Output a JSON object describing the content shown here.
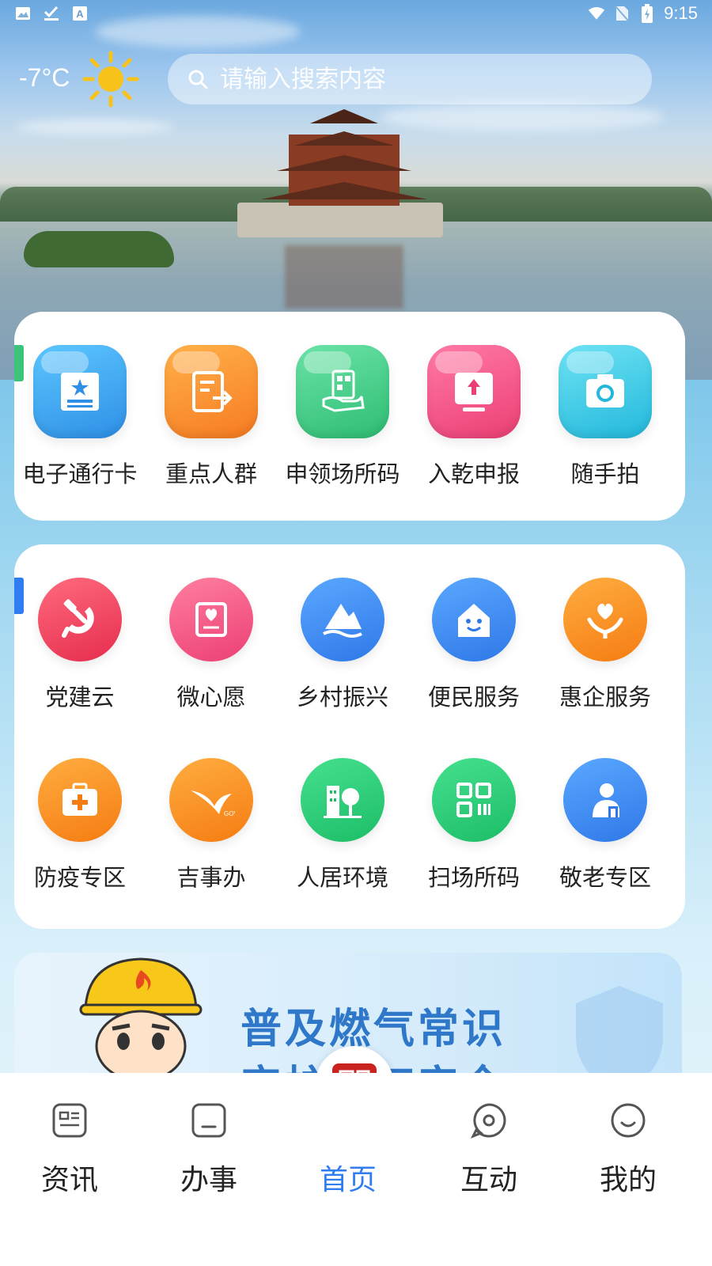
{
  "status_bar": {
    "time": "9:15"
  },
  "header": {
    "temperature": "-7°C",
    "weather_icon": "sun-icon",
    "search_placeholder": "请输入搜索内容"
  },
  "quick_services": [
    {
      "label": "电子通行卡",
      "icon": "id-card-icon",
      "color": "#3aa6f0"
    },
    {
      "label": "重点人群",
      "icon": "document-arrow-icon",
      "color": "#f7922f"
    },
    {
      "label": "申领场所码",
      "icon": "hand-qr-icon",
      "color": "#3ecf86"
    },
    {
      "label": "入乾申报",
      "icon": "upload-icon",
      "color": "#f24f84"
    },
    {
      "label": "随手拍",
      "icon": "camera-icon",
      "color": "#3cc9e6"
    }
  ],
  "services": [
    {
      "label": "党建云",
      "icon": "hammer-sickle-icon",
      "color": "#f0445f"
    },
    {
      "label": "微心愿",
      "icon": "heart-card-icon",
      "color": "#f25a84"
    },
    {
      "label": "乡村振兴",
      "icon": "mountain-icon",
      "color": "#3d8ef0"
    },
    {
      "label": "便民服务",
      "icon": "smile-house-icon",
      "color": "#3b8cf0"
    },
    {
      "label": "惠企服务",
      "icon": "heart-hands-icon",
      "color": "#f78d22"
    },
    {
      "label": "防疫专区",
      "icon": "medical-kit-icon",
      "color": "#f7922f"
    },
    {
      "label": "吉事办",
      "icon": "bird-icon",
      "color": "#f7922f"
    },
    {
      "label": "人居环境",
      "icon": "building-tree-icon",
      "color": "#2ed47a"
    },
    {
      "label": "扫场所码",
      "icon": "qr-code-icon",
      "color": "#2ed47a"
    },
    {
      "label": "敬老专区",
      "icon": "elderly-icon",
      "color": "#3b8cf0"
    }
  ],
  "banner": {
    "line1": "普及燃气常识",
    "line2": "守护燃气安全"
  },
  "bottom_nav": [
    {
      "label": "资讯",
      "icon": "news-icon",
      "active": false
    },
    {
      "label": "办事",
      "icon": "task-icon",
      "active": false
    },
    {
      "label": "首页",
      "icon": "home-seal-icon",
      "active": true
    },
    {
      "label": "互动",
      "icon": "chat-icon",
      "active": false
    },
    {
      "label": "我的",
      "icon": "profile-icon",
      "active": false
    }
  ],
  "colors": {
    "accent": "#2f7df0",
    "green_mark": "#3cc47a",
    "blue_mark": "#2f7df0"
  }
}
